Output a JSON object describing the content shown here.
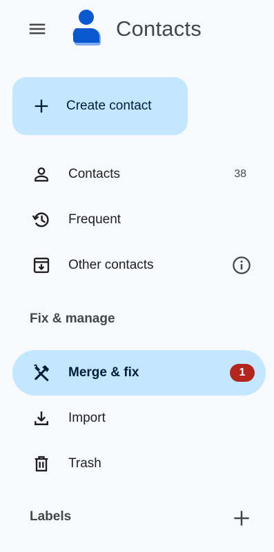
{
  "app": {
    "title": "Contacts",
    "menu_icon": "hamburger-menu-icon",
    "logo_icon": "contacts-person-logo"
  },
  "create": {
    "label": "Create contact",
    "icon": "plus-icon"
  },
  "nav": {
    "contacts": {
      "label": "Contacts",
      "count": "38",
      "icon": "person-icon"
    },
    "frequent": {
      "label": "Frequent",
      "icon": "history-icon"
    },
    "other": {
      "label": "Other contacts",
      "icon": "archive-download-icon",
      "info_icon": "info-icon"
    }
  },
  "fix_section": {
    "title": "Fix & manage",
    "items": {
      "merge": {
        "label": "Merge & fix",
        "badge": "1",
        "icon": "tools-icon"
      },
      "import": {
        "label": "Import",
        "icon": "download-icon"
      },
      "trash": {
        "label": "Trash",
        "icon": "trash-icon"
      }
    }
  },
  "labels_section": {
    "title": "Labels",
    "add_icon": "plus-icon"
  },
  "colors": {
    "background": "#f7f9fc",
    "accent_container": "#c2e7ff",
    "badge": "#b3261e",
    "logo_dark": "#0b57d0",
    "logo_light": "#7cacf8"
  }
}
